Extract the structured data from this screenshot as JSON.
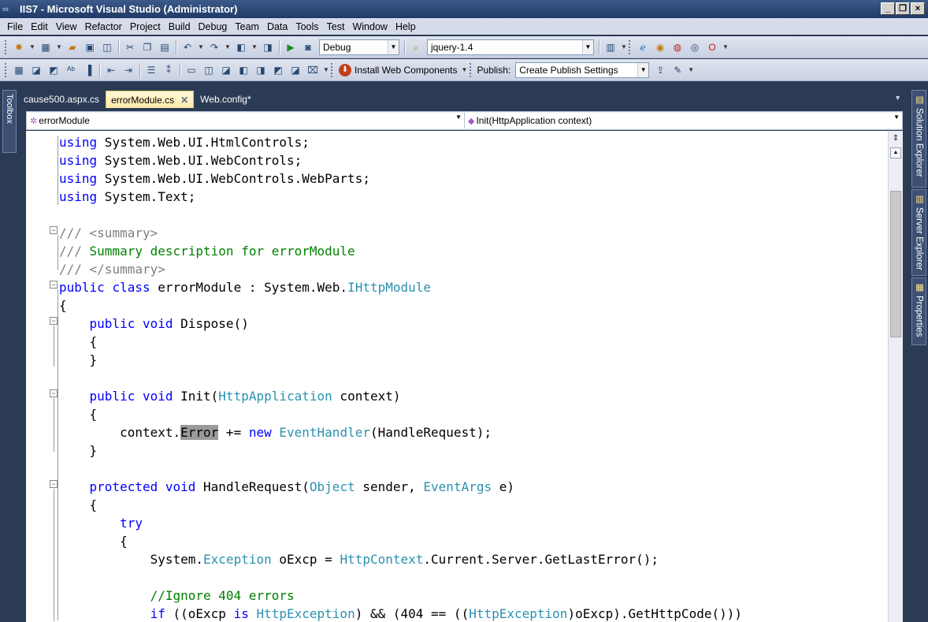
{
  "window": {
    "title": "IIS7 - Microsoft Visual Studio (Administrator)",
    "min": "_",
    "max": "❐",
    "close": "×"
  },
  "menu": [
    "File",
    "Edit",
    "View",
    "Refactor",
    "Project",
    "Build",
    "Debug",
    "Team",
    "Data",
    "Tools",
    "Test",
    "Window",
    "Help"
  ],
  "toolbar1": {
    "config": "Debug",
    "find": "jquery-1.4"
  },
  "toolbar2": {
    "install_label": "Install Web Components",
    "publish_label": "Publish:",
    "publish_value": "Create Publish Settings"
  },
  "left_panel": {
    "toolbox": "Toolbox"
  },
  "right_panel": {
    "solution": "Solution Explorer",
    "server": "Server Explorer",
    "properties": "Properties"
  },
  "tabs": [
    {
      "label": "cause500.aspx.cs",
      "active": false
    },
    {
      "label": "errorModule.cs",
      "active": true
    },
    {
      "label": "Web.config*",
      "active": false
    }
  ],
  "nav": {
    "type": "errorModule",
    "member": "Init(HttpApplication context)"
  },
  "code": [
    "using System.Web.UI.HtmlControls;",
    "using System.Web.UI.WebControls;",
    "using System.Web.UI.WebControls.WebParts;",
    "using System.Text;",
    "",
    "/// <summary>",
    "/// Summary description for errorModule",
    "/// </summary>",
    "public class errorModule : System.Web.IHttpModule",
    "{",
    "    public void Dispose()",
    "    {",
    "    }",
    "",
    "    public void Init(HttpApplication context)",
    "    {",
    "        context.Error += new EventHandler(HandleRequest);",
    "    }",
    "",
    "    protected void HandleRequest(Object sender, EventArgs e)",
    "    {",
    "        try",
    "        {",
    "            System.Exception oExcp = HttpContext.Current.Server.GetLastError();",
    "",
    "            //Ignore 404 errors",
    "            if ((oExcp is HttpException) && (404 == ((HttpException)oExcp).GetHttpCode()))"
  ],
  "colors": {
    "keyword": "#0000ff",
    "type": "#2b91af",
    "comment": "#008000",
    "xmldoc": "#808080"
  }
}
